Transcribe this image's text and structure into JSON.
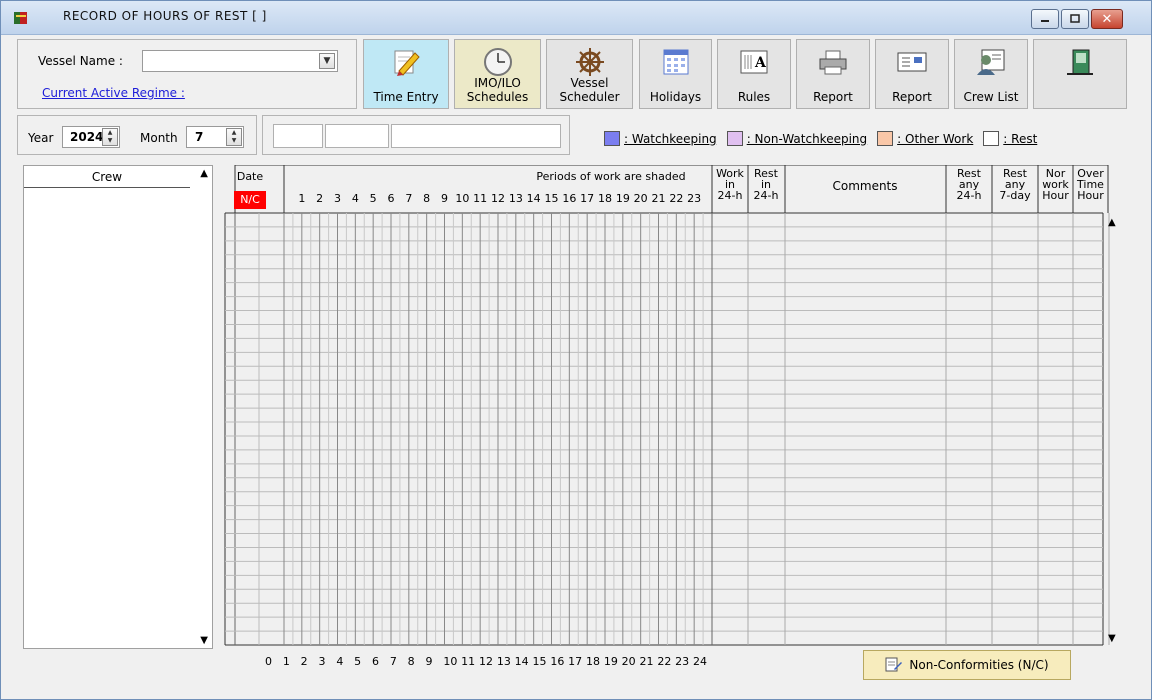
{
  "window": {
    "title": "RECORD  OF  HOURS  OF  REST   [  ]",
    "minimize_icon": "minimize-icon",
    "maximize_icon": "maximize-icon",
    "close_icon": "close-icon"
  },
  "vessel": {
    "label": "Vessel Name :",
    "selected": "",
    "regime_link": "Current Active Regime :"
  },
  "toolbar": [
    {
      "label": "Time Entry",
      "icon": "pencil-icon"
    },
    {
      "label": "IMO/ILO\nSchedules",
      "icon": "clock-icon"
    },
    {
      "label": "Vessel\nScheduler",
      "icon": "ship-wheel-icon"
    },
    {
      "label": "Holidays",
      "icon": "calendar-icon"
    },
    {
      "label": "Rules",
      "icon": "rules-book-icon"
    },
    {
      "label": "Report",
      "icon": "printer-icon"
    },
    {
      "label": "Report",
      "icon": "report-icon"
    },
    {
      "label": "Crew List",
      "icon": "crew-list-icon"
    },
    {
      "label": "",
      "icon": "exit-door-icon"
    }
  ],
  "period": {
    "year_label": "Year",
    "year": "2024",
    "month_label": "Month",
    "month": "7"
  },
  "legend": [
    {
      "label": ": Watchkeeping",
      "color": "#7b7ef0"
    },
    {
      "label": ": Non-Watchkeeping",
      "color": "#e0c0f0"
    },
    {
      "label": ": Other Work",
      "color": "#f9c7a8"
    },
    {
      "label": ": Rest",
      "color": "#ffffff"
    }
  ],
  "crew": {
    "header": "Crew"
  },
  "grid": {
    "date_header": "Date",
    "nc_badge": "N/C",
    "periods_header": "Periods of work are shaded",
    "hour_labels": [
      "1",
      "2",
      "3",
      "4",
      "5",
      "6",
      "7",
      "8",
      "9",
      "10",
      "11",
      "12",
      "13",
      "14",
      "15",
      "16",
      "17",
      "18",
      "19",
      "20",
      "21",
      "22",
      "23"
    ],
    "work_header": [
      "Work",
      "in",
      "24-h"
    ],
    "rest_header": [
      "Rest",
      "in",
      "24-h"
    ],
    "comments_header": "Comments",
    "rest_any_24_header": [
      "Rest",
      "any",
      "24-h"
    ],
    "rest_any_7_header": [
      "Rest",
      "any",
      "7-day"
    ],
    "nor_work_header": [
      "Nor",
      "work",
      "Hour"
    ],
    "overtime_header": [
      "Over",
      "Time",
      "Hour"
    ],
    "bottom_scale": [
      "0",
      "1",
      "2",
      "3",
      "4",
      "5",
      "6",
      "7",
      "8",
      "9",
      "10",
      "11",
      "12",
      "13",
      "14",
      "15",
      "16",
      "17",
      "18",
      "19",
      "20",
      "21",
      "22",
      "23",
      "24"
    ]
  },
  "nc_button": {
    "label": "Non-Conformities (N/C)"
  }
}
